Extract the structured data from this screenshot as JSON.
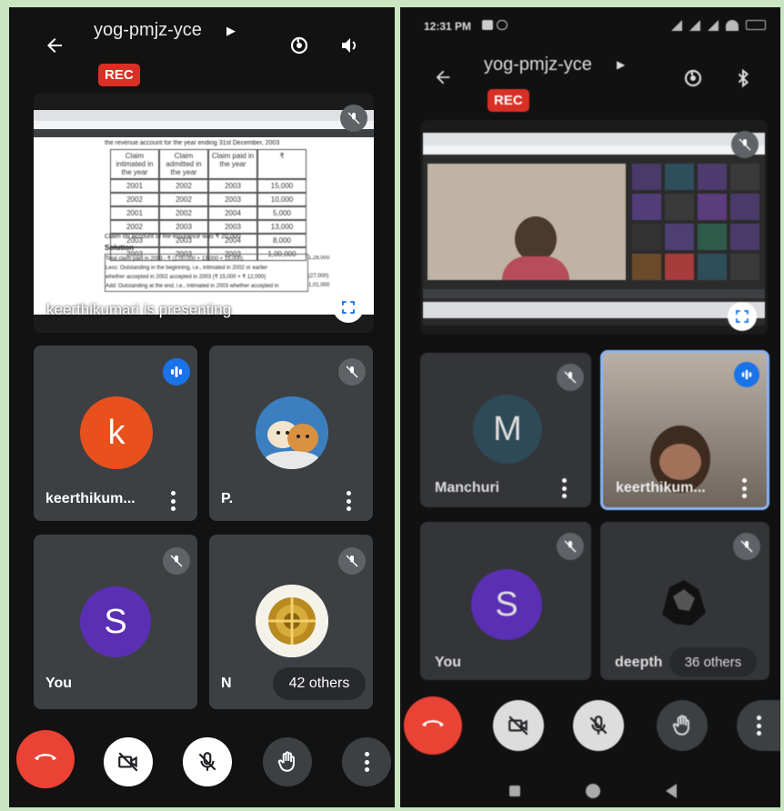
{
  "left": {
    "meeting_code": "yog-pmjz-yce",
    "rec_label": "REC",
    "presentation": {
      "caption": "keerthikumari is presenting",
      "doc_line": "the revenue account for the year ending 31st December, 2003",
      "table_headers": [
        "Claim intimated in the year",
        "Claim admitted in the year",
        "Claim paid in the year",
        "₹"
      ],
      "table_rows": [
        [
          "2001",
          "2002",
          "2003",
          "15,000"
        ],
        [
          "2002",
          "2002",
          "2003",
          "10,000"
        ],
        [
          "2001",
          "2002",
          "2004",
          "5,000"
        ],
        [
          "2002",
          "2003",
          "2003",
          "13,000"
        ],
        [
          "2003",
          "2003",
          "2004",
          "8,000"
        ],
        [
          "2003",
          "2003",
          "2003",
          "1,00,000"
        ]
      ],
      "note": "Claim on account of Re-insurance was ₹ 20,000",
      "solution_heading": "Solution",
      "solution_lines": [
        "Total claim paid in 2003 - ₹ (1,00,000 + 13,000 + 15,000)",
        "Less: Outstanding in the beginning, i.e., intimated in 2002 or earlier",
        "whether accepted in 2002 accepted in 2003 (₹ 15,000 + ₹ 12,000)",
        "Add: Outstanding at the end, i.e., intimated in 2003 whether accepted in"
      ],
      "solution_values": [
        "1,28,000",
        "",
        "(27,000)",
        "1,01,000"
      ]
    },
    "tiles": [
      {
        "name": "keerthikum...",
        "avatar_letter": "k",
        "avatar_color": "#e8501d"
      },
      {
        "name": "P.",
        "avatar_image": "dog-photo"
      },
      {
        "name": "You",
        "avatar_letter": "S",
        "avatar_color": "#5a2fb3"
      },
      {
        "name": "N",
        "avatar_image": "gold-ornament-photo",
        "others": "42 others"
      }
    ],
    "controls": [
      "end-call",
      "camera-off",
      "mic-off",
      "raise-hand",
      "more"
    ]
  },
  "right": {
    "status_time": "12:31 PM",
    "meeting_code": "yog-pmjz-yce",
    "rec_label": "REC",
    "tiles": [
      {
        "name": "Manchuri",
        "avatar_letter": "M",
        "avatar_color": "#2e4a56"
      },
      {
        "name": "keerthikum...",
        "avatar_image": "video-feed"
      },
      {
        "name": "You",
        "avatar_letter": "S",
        "avatar_color": "#5a2fb3"
      },
      {
        "name": "deepth",
        "avatar_image": "dark-photo",
        "others": "36 others"
      }
    ],
    "colors": {
      "end_call": "#ea4335",
      "rec": "#d93025",
      "speaking": "#1a73e8"
    }
  }
}
